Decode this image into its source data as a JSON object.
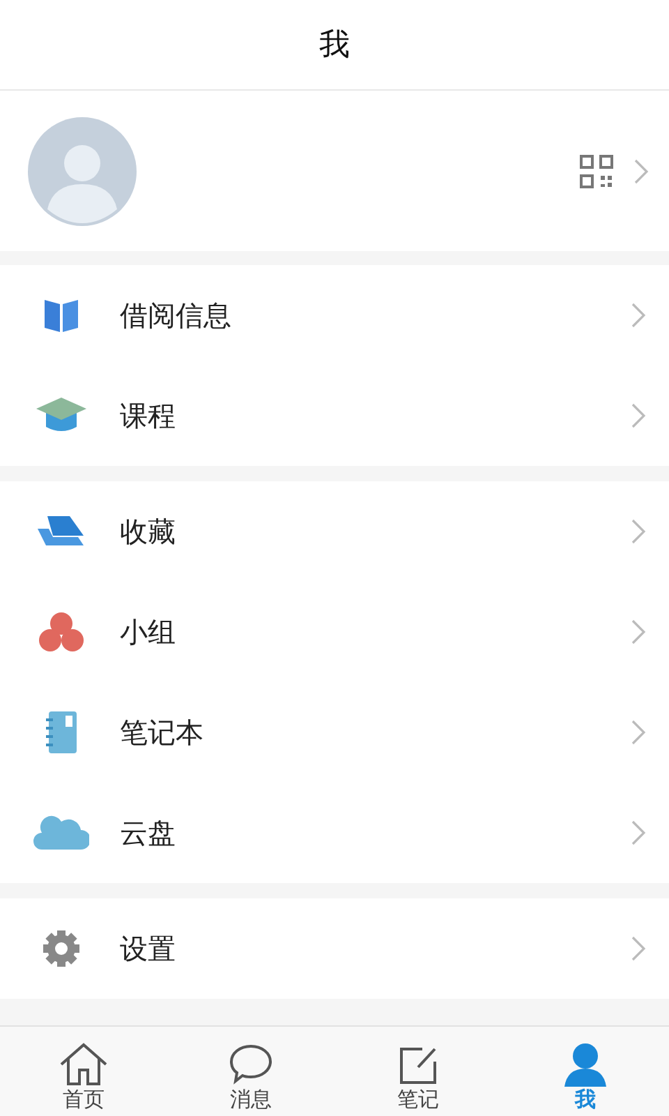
{
  "header": {
    "title": "我"
  },
  "groups": [
    {
      "items": [
        {
          "kind": "book",
          "label": "借阅信息"
        },
        {
          "kind": "cap",
          "label": "课程"
        }
      ]
    },
    {
      "items": [
        {
          "kind": "stack",
          "label": "收藏"
        },
        {
          "kind": "group",
          "label": "小组"
        },
        {
          "kind": "notebook",
          "label": "笔记本"
        },
        {
          "kind": "cloud",
          "label": "云盘"
        }
      ]
    },
    {
      "items": [
        {
          "kind": "gear",
          "label": "设置"
        }
      ]
    }
  ],
  "tabs": [
    {
      "kind": "home",
      "label": "首页",
      "selected": false
    },
    {
      "kind": "chat",
      "label": "消息",
      "selected": false
    },
    {
      "kind": "note",
      "label": "笔记",
      "selected": false
    },
    {
      "kind": "person",
      "label": "我",
      "selected": true
    }
  ]
}
